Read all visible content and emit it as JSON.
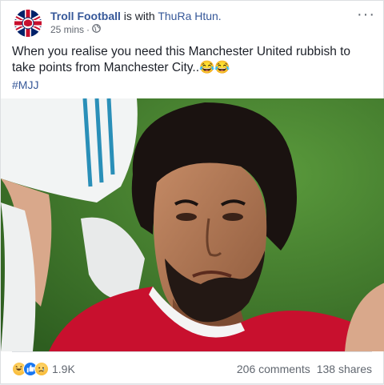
{
  "post": {
    "author": "Troll Football",
    "with_text": "is with",
    "tagged": "ThuRa Htun.",
    "time": "25 mins",
    "privacy_separator": "·",
    "text": "When you realise you need this Manchester United rubbish to take points from Manchester City..😂😂",
    "hashtag": "#MJJ",
    "more_label": "···"
  },
  "footer": {
    "reaction_count": "1.9K",
    "comments": "206 comments",
    "shares": "138 shares",
    "reaction_icons": [
      "haha-icon",
      "like-icon",
      "sad-icon"
    ]
  },
  "colors": {
    "link": "#365899",
    "pitch": "#3d7a2a",
    "shirt": "#c8102e"
  }
}
